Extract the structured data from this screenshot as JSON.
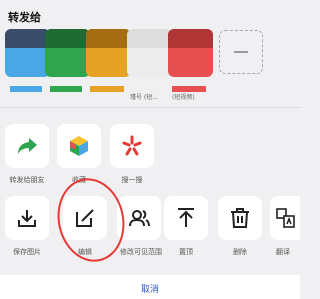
{
  "sheet": {
    "title": "转发给",
    "tiles": [
      {
        "bottom": "#4aa7e6",
        "top": "#3a4c6a"
      },
      {
        "bottom": "#2ea54e",
        "top": "#1f6b33"
      },
      {
        "bottom": "#e6a225",
        "top": "#a46d10"
      },
      {
        "bottom": "#ececec",
        "top": "#dddddd"
      },
      {
        "bottom": "#e65050",
        "top": "#b03535"
      }
    ],
    "contact_labels": [
      "瑾号 (短...",
      "(短视频)"
    ],
    "more_icon": "dash-icon"
  },
  "row1": [
    {
      "label": "转发给朋友",
      "icon": "share-arrow-icon"
    },
    {
      "label": "收藏",
      "icon": "cube-icon"
    },
    {
      "label": "搜一搜",
      "icon": "search-spark-icon"
    }
  ],
  "row2": [
    {
      "label": "保存图片",
      "icon": "download-icon"
    },
    {
      "label": "编辑",
      "icon": "edit-icon"
    },
    {
      "label": "修改可见范围",
      "icon": "people-icon"
    },
    {
      "label": "置顶",
      "icon": "pin-top-icon"
    },
    {
      "label": "删除",
      "icon": "trash-icon"
    },
    {
      "label": "翻译",
      "icon": "translate-icon"
    }
  ],
  "cancel_label": "取消",
  "colors": {
    "accent": "#2b56c6",
    "highlight": "#e53935",
    "share_green": "#2ea54e"
  }
}
